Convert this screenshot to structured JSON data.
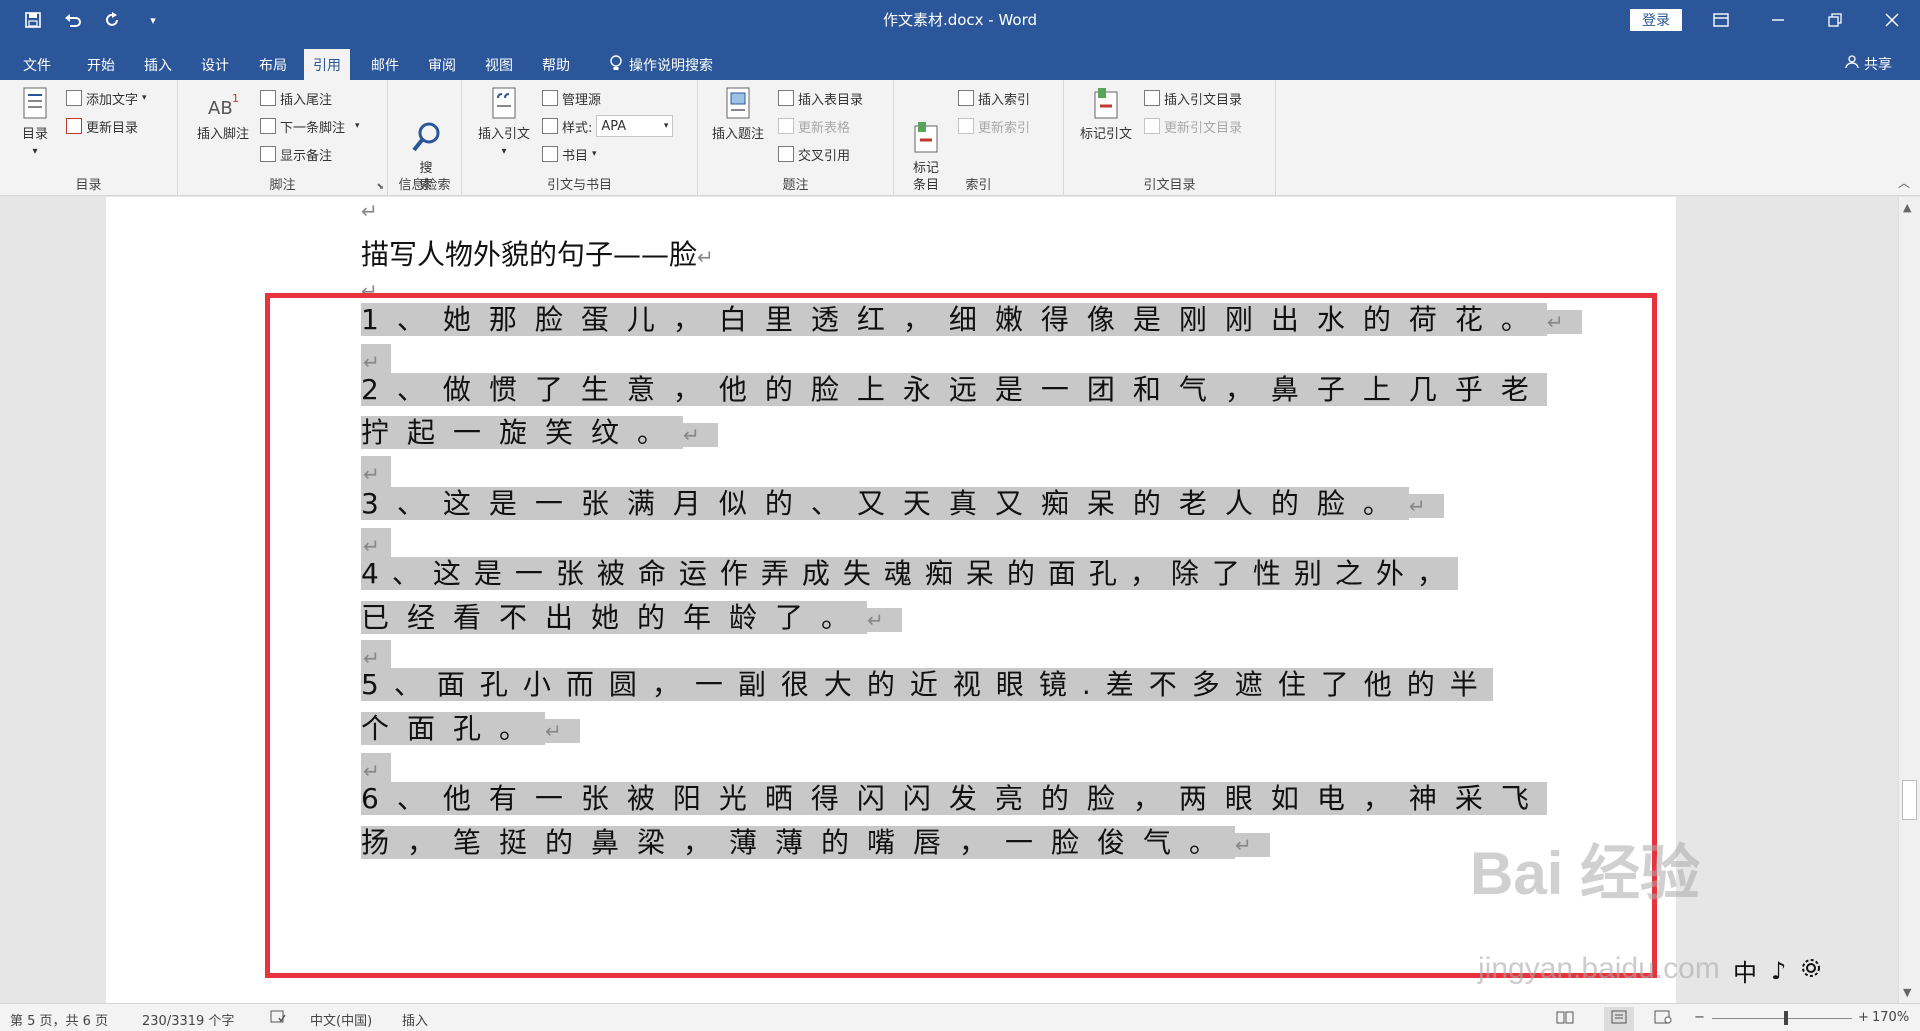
{
  "window": {
    "title": "作文素材.docx  -  Word",
    "login_label": "登录",
    "qat_icons": [
      "save-icon",
      "undo-icon",
      "redo-icon",
      "customize-icon"
    ],
    "controls": [
      "ribbon-display-icon",
      "minimize-icon",
      "restore-icon",
      "close-icon"
    ]
  },
  "tabs": [
    {
      "label": "文件"
    },
    {
      "label": "开始"
    },
    {
      "label": "插入"
    },
    {
      "label": "设计"
    },
    {
      "label": "布局"
    },
    {
      "label": "引用",
      "active": true
    },
    {
      "label": "邮件"
    },
    {
      "label": "审阅"
    },
    {
      "label": "视图"
    },
    {
      "label": "帮助"
    },
    {
      "label": "操作说明搜索"
    }
  ],
  "share_label": "共享",
  "ribbon": {
    "toc": {
      "group_label": "目录",
      "toc_label": "目录",
      "add_text": "添加文字",
      "update_toc": "更新目录"
    },
    "footnotes": {
      "group_label": "脚注",
      "insert_footnote": "插入脚注",
      "insert_endnote": "插入尾注",
      "next_footnote": "下一条脚注",
      "show_notes": "显示备注"
    },
    "research": {
      "group_label": "信息检索",
      "search_label": "搜\n索"
    },
    "citations": {
      "group_label": "引文与书目",
      "insert_citation": "插入引文",
      "manage_sources": "管理源",
      "style_label": "样式:",
      "style_value": "APA",
      "bibliography": "书目"
    },
    "captions": {
      "group_label": "题注",
      "insert_caption": "插入题注",
      "insert_table_of_figures": "插入表目录",
      "update_table": "更新表格",
      "cross_reference": "交叉引用"
    },
    "index": {
      "group_label": "索引",
      "mark_entry": "标记\n条目",
      "insert_index": "插入索引",
      "update_index": "更新索引"
    },
    "toa": {
      "group_label": "引文目录",
      "mark_citation": "标记引文",
      "insert_toa": "插入引文目录",
      "update_toa": "更新引文目录"
    }
  },
  "document": {
    "heading": "描写人物外貌的句子——脸",
    "paragraph_mark": "↵",
    "items": [
      {
        "lines": [
          "1、她那脸蛋儿，白里透红，细嫩得像是刚刚出水的荷花。"
        ]
      },
      {
        "lines": [
          "2、做惯了生意，他的脸上永远是一团和气，鼻子上几乎老",
          "拧起一旋笑纹。"
        ]
      },
      {
        "lines": [
          "3、这是一张满月似的、又天真又痴呆的老人的脸。"
        ]
      },
      {
        "lines": [
          "4、这是一张被命运作弄成失魂痴呆的面孔，除了性别之外，",
          "已经看不出她的年龄了。"
        ]
      },
      {
        "lines": [
          "5、面孔小而圆，一副很大的近视眼镜.差不多遮住了他的半",
          "个面孔。"
        ]
      },
      {
        "lines": [
          "6、他有一张被阳光晒得闪闪发亮的脸，两眼如电，神采飞",
          "扬，笔挺的鼻梁，薄薄的嘴唇，一脸俊气。"
        ]
      }
    ]
  },
  "watermark": {
    "brand": "Bai 经验",
    "url": "jingyan.baidu.com"
  },
  "ime": {
    "lang": "中",
    "mode": "♪"
  },
  "statusbar": {
    "page": "第 5 页，共 6 页",
    "words": "230/3319 个字",
    "language": "中文(中国)",
    "mode": "插入",
    "zoom": "170%",
    "zoom_minus": "−",
    "zoom_plus": "+"
  }
}
